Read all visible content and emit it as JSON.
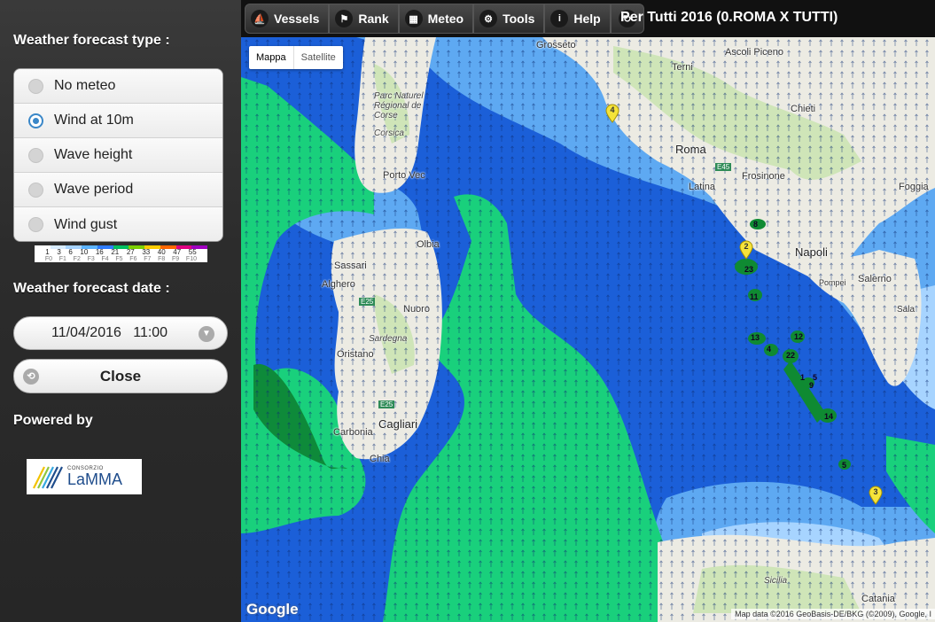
{
  "sidebar": {
    "forecast_type_heading": "Weather forecast type :",
    "options": [
      {
        "label": "No meteo",
        "checked": false
      },
      {
        "label": "Wind at 10m",
        "checked": true
      },
      {
        "label": "Wave height",
        "checked": false
      },
      {
        "label": "Wave period",
        "checked": false
      },
      {
        "label": "Wind gust",
        "checked": false
      }
    ],
    "scale": {
      "numbers": [
        "1",
        "3",
        "6",
        "10",
        "16",
        "21",
        "27",
        "33",
        "40",
        "47",
        "55"
      ],
      "force_labels": [
        "F0",
        "F1",
        "F2",
        "F3",
        "F4",
        "F5",
        "F6",
        "F7",
        "F8",
        "F9",
        "F10"
      ],
      "colors": [
        "#ffffff",
        "#d8ecff",
        "#a6d3ff",
        "#5bb3ff",
        "#2e7cff",
        "#00c060",
        "#7bd000",
        "#ffcc00",
        "#ff6600",
        "#e00080",
        "#a000c0"
      ]
    },
    "date_heading": "Weather forecast date :",
    "date_value": "11/04/2016   11:00",
    "close_label": "Close",
    "powered_heading": "Powered by",
    "logo": {
      "small": "CONSORZIO",
      "big": "LaMMA"
    }
  },
  "toolbar": {
    "buttons": [
      {
        "label": "Vessels",
        "icon": "sailboat-icon",
        "glyph": "⛵"
      },
      {
        "label": "Rank",
        "icon": "checkered-flag-icon",
        "glyph": "⚑"
      },
      {
        "label": "Meteo",
        "icon": "grid-icon",
        "glyph": "▦"
      },
      {
        "label": "Tools",
        "icon": "gear-icon",
        "glyph": "⚙"
      },
      {
        "label": "Help",
        "icon": "info-icon",
        "glyph": "i"
      },
      {
        "label": "",
        "icon": "refresh-icon",
        "glyph": "↻"
      }
    ],
    "title": "Per Tutti 2016 (0.ROMA X TUTTI)"
  },
  "map": {
    "map_type": [
      "Mappa",
      "Satellite"
    ],
    "active_type": "Mappa",
    "google": "Google",
    "attribution": "Map data ©2016 GeoBasis-DE/BKG (©2009), Google, I",
    "colors": {
      "sea": "#1b5fd8",
      "light_blue": "#5ea9f2",
      "pale_blue": "#a7d4ff",
      "green": "#19d07c",
      "dark_green": "#0e8a3a",
      "land": "#ecebe3",
      "land_green": "#cfe5b8",
      "boat_green": "#0f8a32",
      "marker": "#f5e33a"
    },
    "places": [
      "Grosseto",
      "Ascoli Piceno",
      "Terni",
      "Chieti",
      "Roma",
      "Frosinone",
      "Latina",
      "Foggia",
      "Napoli",
      "Salerno",
      "Parc Naturel Régional de Corse",
      "Corsica",
      "Porto Vec",
      "Olbia",
      "Sassari",
      "Alghero",
      "Nuoro",
      "Sardegna",
      "Oristano",
      "Cagliari",
      "Carbonia",
      "Chia",
      "E45",
      "E25",
      "E25",
      "Pompei",
      "Sala",
      "Catania",
      "Sicilia",
      "Catania"
    ],
    "markers": [
      "4",
      "2",
      "3"
    ],
    "boats": [
      "8",
      "23",
      "11",
      "13",
      "4",
      "12",
      "22",
      "1",
      "5",
      "9",
      "14",
      "5"
    ]
  }
}
